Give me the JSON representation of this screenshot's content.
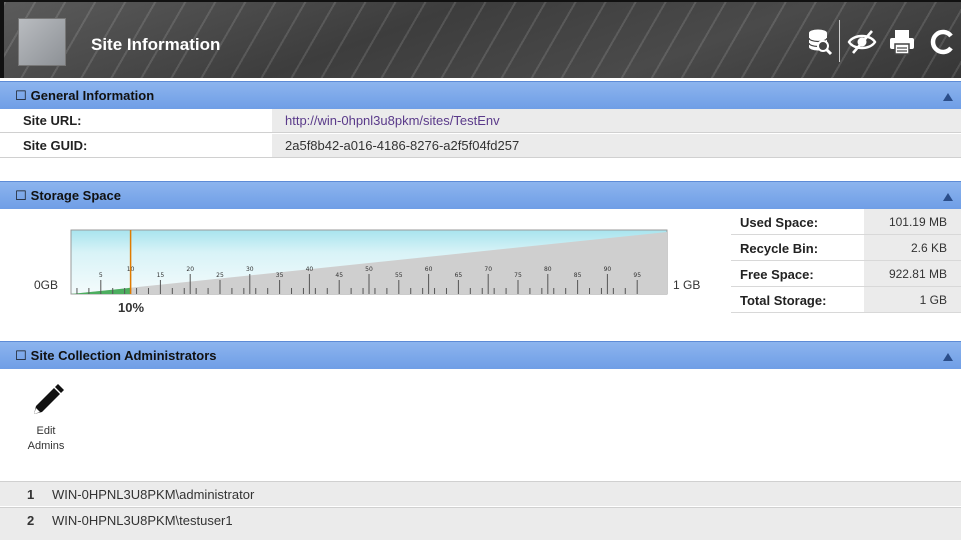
{
  "header": {
    "title": "Site Information",
    "tools": [
      "database-search-icon",
      "eye-off-icon",
      "printer-icon",
      "refresh-icon"
    ]
  },
  "general": {
    "title": "General Information",
    "rows": [
      {
        "label": "Site URL:",
        "value": "http://win-0hpnl3u8pkm/sites/TestEnv"
      },
      {
        "label": "Site GUID:",
        "value": "2a5f8b42-a016-4186-8276-a2f5f04fd257"
      }
    ]
  },
  "storage": {
    "title": "Storage Space",
    "gauge": {
      "min_label": "0GB",
      "max_label": "1 GB",
      "percent_label": "10%",
      "used_fraction": 0.1,
      "tick_labels": [
        "5",
        "10",
        "15",
        "20",
        "25",
        "30",
        "35",
        "40",
        "45",
        "50",
        "55",
        "60",
        "65",
        "70",
        "75",
        "80",
        "85",
        "90",
        "95"
      ]
    },
    "stats": [
      {
        "label": "Used Space:",
        "value": "101.19 MB"
      },
      {
        "label": "Recycle Bin:",
        "value": "2.6 KB"
      },
      {
        "label": "Free Space:",
        "value": "922.81 MB"
      },
      {
        "label": "Total Storage:",
        "value": "1 GB"
      }
    ]
  },
  "admins": {
    "title": "Site Collection Administrators",
    "edit_label_1": "Edit",
    "edit_label_2": "Admins",
    "list": [
      {
        "num": "1",
        "name": "WIN-0HPNL3U8PKM\\administrator"
      },
      {
        "num": "2",
        "name": "WIN-0HPNL3U8PKM\\testuser1"
      }
    ]
  },
  "colors": {
    "section_header": "#7aa7ea",
    "gauge_used": "#4cae5f",
    "gauge_marker": "#e07b00"
  }
}
